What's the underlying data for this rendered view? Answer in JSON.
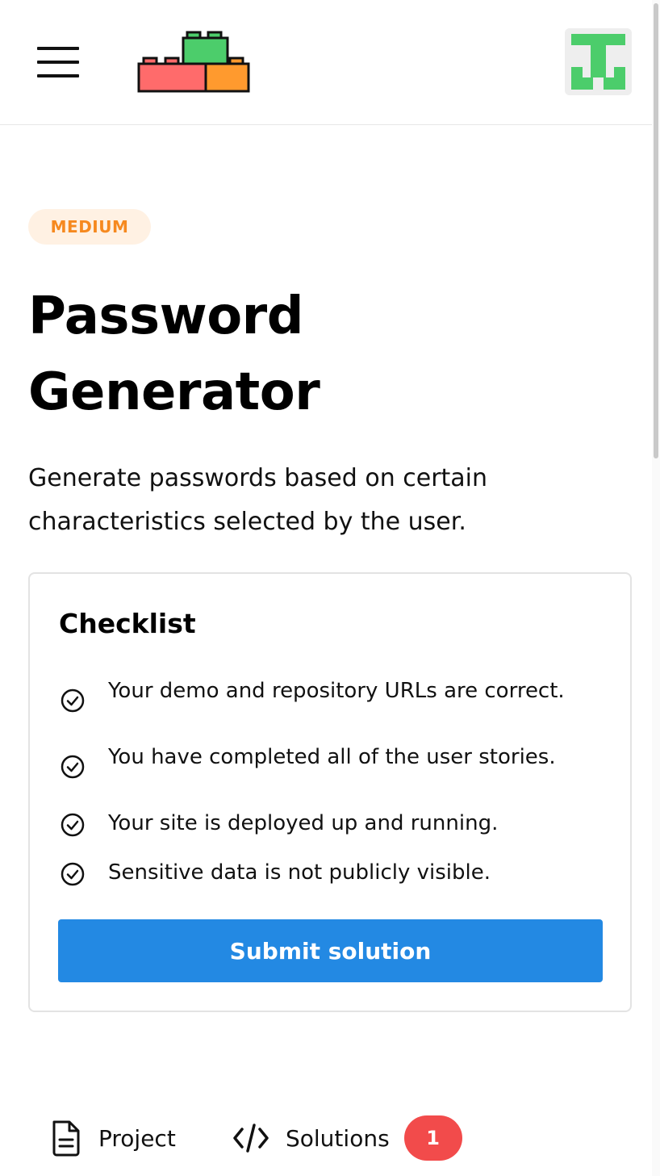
{
  "header": {
    "menu_icon": "hamburger-menu-icon",
    "logo_icon": "lego-bricks-logo",
    "avatar_icon": "user-avatar",
    "colors": {
      "brick_red": "#ff6b6b",
      "brick_green": "#4ccd6b",
      "brick_orange": "#ff9a2e",
      "avatar_green": "#4ccd6b"
    }
  },
  "project": {
    "difficulty": "MEDIUM",
    "title_line1": "Password",
    "title_line2": "Generator",
    "description": "Generate passwords based on certain characteristics selected by the user."
  },
  "checklist": {
    "title": "Checklist",
    "items": [
      {
        "text": "Your demo and repository URLs are correct.",
        "icon": "check-circle-icon"
      },
      {
        "text": "You have completed all of the user stories.",
        "icon": "check-circle-icon"
      },
      {
        "text": "Your site is deployed up and running.",
        "icon": "check-circle-icon"
      },
      {
        "text": "Sensitive data is not publicly visible.",
        "icon": "check-circle-icon"
      }
    ],
    "submit_label": "Submit solution"
  },
  "tabs": {
    "project": {
      "label": "Project",
      "icon": "document-icon"
    },
    "solutions": {
      "label": "Solutions",
      "icon": "code-icon",
      "count": "1"
    }
  },
  "colors": {
    "accent": "#2389e3",
    "badge_text": "#f6891f",
    "badge_bg": "#fff1e3",
    "count_bg": "#f24b4b"
  }
}
